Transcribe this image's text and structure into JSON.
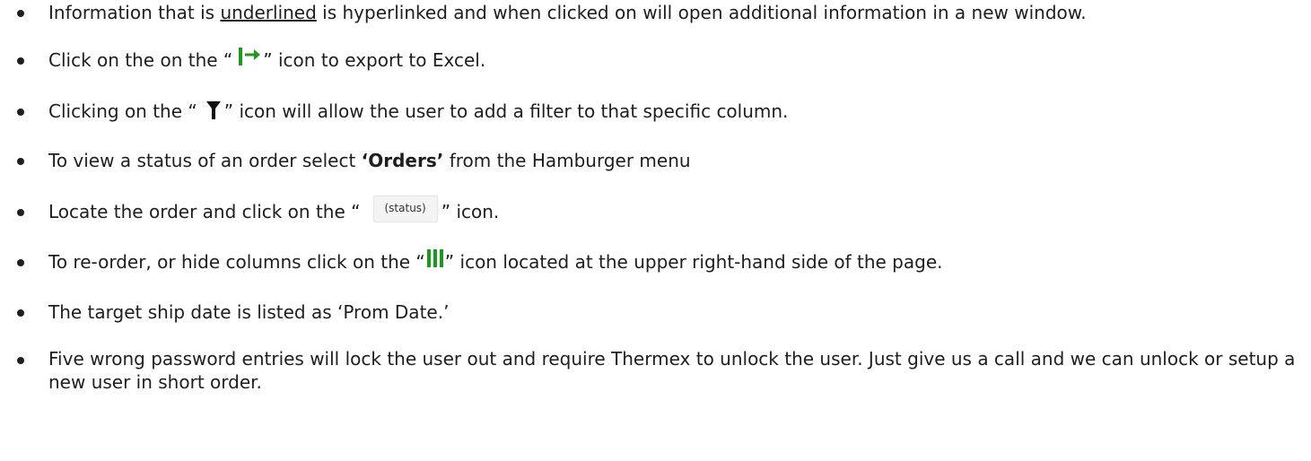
{
  "items": [
    {
      "before": "Information that is ",
      "link": "underlined",
      "after": " is hyperlinked and when clicked on will open additional information in a new window."
    },
    {
      "before": "Click on the on the “",
      "icon": "export-to-excel-icon",
      "after": "” icon to export to Excel."
    },
    {
      "before": "Clicking on the “",
      "icon": "filter-funnel-icon",
      "after": "” icon will allow the user to add a filter to that specific column."
    },
    {
      "before": "To view a status of an order select ",
      "bold": "‘Orders’",
      "after": " from the Hamburger menu"
    },
    {
      "before": "Locate the order and click on the “",
      "button": "(status)",
      "after": "” icon."
    },
    {
      "before": "To re-order, or hide columns click on the “",
      "icon": "columns-icon",
      "after": "” icon located at the upper right-hand side of the page."
    },
    {
      "text": "The target ship date is listed as ‘Prom Date.’"
    },
    {
      "text": "Five wrong password entries will lock the user out and require Thermex to unlock the user. Just give us a call and we can unlock or setup a new user in short order."
    }
  ],
  "colors": {
    "text": "#1e1e1e",
    "icon_green": "#1a9b1a",
    "icon_dark": "#111111"
  }
}
